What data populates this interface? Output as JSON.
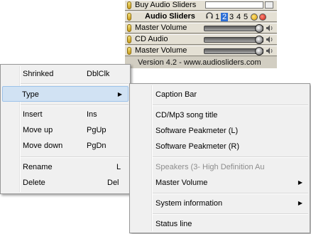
{
  "widget": {
    "rows": [
      {
        "label": "Buy Audio Sliders"
      },
      {
        "label": "Audio Sliders",
        "tabs": [
          "1",
          "2",
          "3",
          "4",
          "5"
        ],
        "selected_tab": "2"
      },
      {
        "label": "Master Volume",
        "level": 1.0
      },
      {
        "label": "CD Audio",
        "level": 1.0
      },
      {
        "label": "Master Volume",
        "level": 1.0
      }
    ],
    "footer": "Version 4.2  -  www.audiosliders.com"
  },
  "context_menu": {
    "items": [
      {
        "label": "Shrinked",
        "shortcut": "DblClk"
      },
      {
        "label": "Type",
        "submenu": true,
        "highlighted": true
      },
      {
        "label": "Insert",
        "shortcut": "Ins"
      },
      {
        "label": "Move up",
        "shortcut": "PgUp"
      },
      {
        "label": "Move down",
        "shortcut": "PgDn"
      },
      {
        "label": "Rename",
        "shortcut": "L"
      },
      {
        "label": "Delete",
        "shortcut": "Del"
      }
    ]
  },
  "type_submenu": {
    "items": [
      {
        "label": "Caption Bar"
      },
      {
        "label": "CD/Mp3 song title"
      },
      {
        "label": "Software Peakmeter (L)"
      },
      {
        "label": "Software Peakmeter (R)"
      },
      {
        "label": "Speakers (3- High Definition Au",
        "disabled": true
      },
      {
        "label": "Master Volume",
        "submenu": true
      },
      {
        "label": "System information",
        "submenu": true
      },
      {
        "label": "Status line"
      }
    ]
  },
  "colors": {
    "highlight": "#d1e2f3",
    "selected_tab": "#2d6fd6",
    "widget_bg": "#e4e0d4"
  }
}
